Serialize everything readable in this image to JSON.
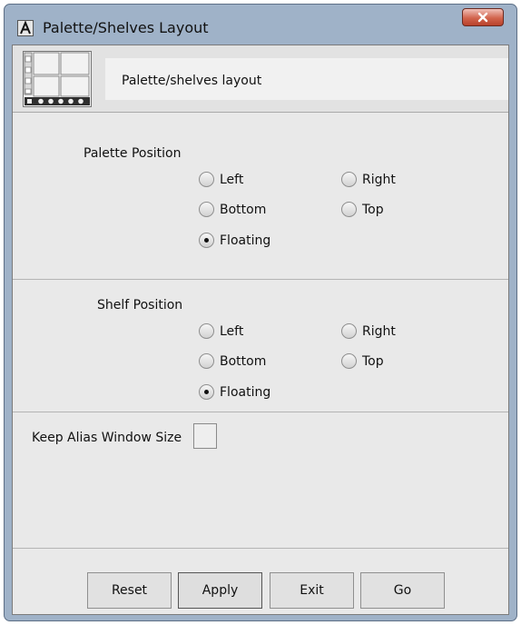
{
  "window": {
    "title": "Palette/Shelves Layout",
    "app_icon_glyph": "A",
    "close_glyph": "X"
  },
  "header": {
    "text": "Palette/shelves layout",
    "icon": "layout-grid-icon"
  },
  "palette": {
    "title": "Palette Position",
    "options": [
      "Left",
      "Right",
      "Bottom",
      "Top",
      "Floating"
    ],
    "selected": "Floating"
  },
  "shelf": {
    "title": "Shelf Position",
    "options": [
      "Left",
      "Right",
      "Bottom",
      "Top",
      "Floating"
    ],
    "selected": "Floating"
  },
  "keep_alias": {
    "label": "Keep Alias Window Size",
    "checked": false
  },
  "buttons": {
    "reset": "Reset",
    "apply": "Apply",
    "exit": "Exit",
    "go": "Go"
  }
}
